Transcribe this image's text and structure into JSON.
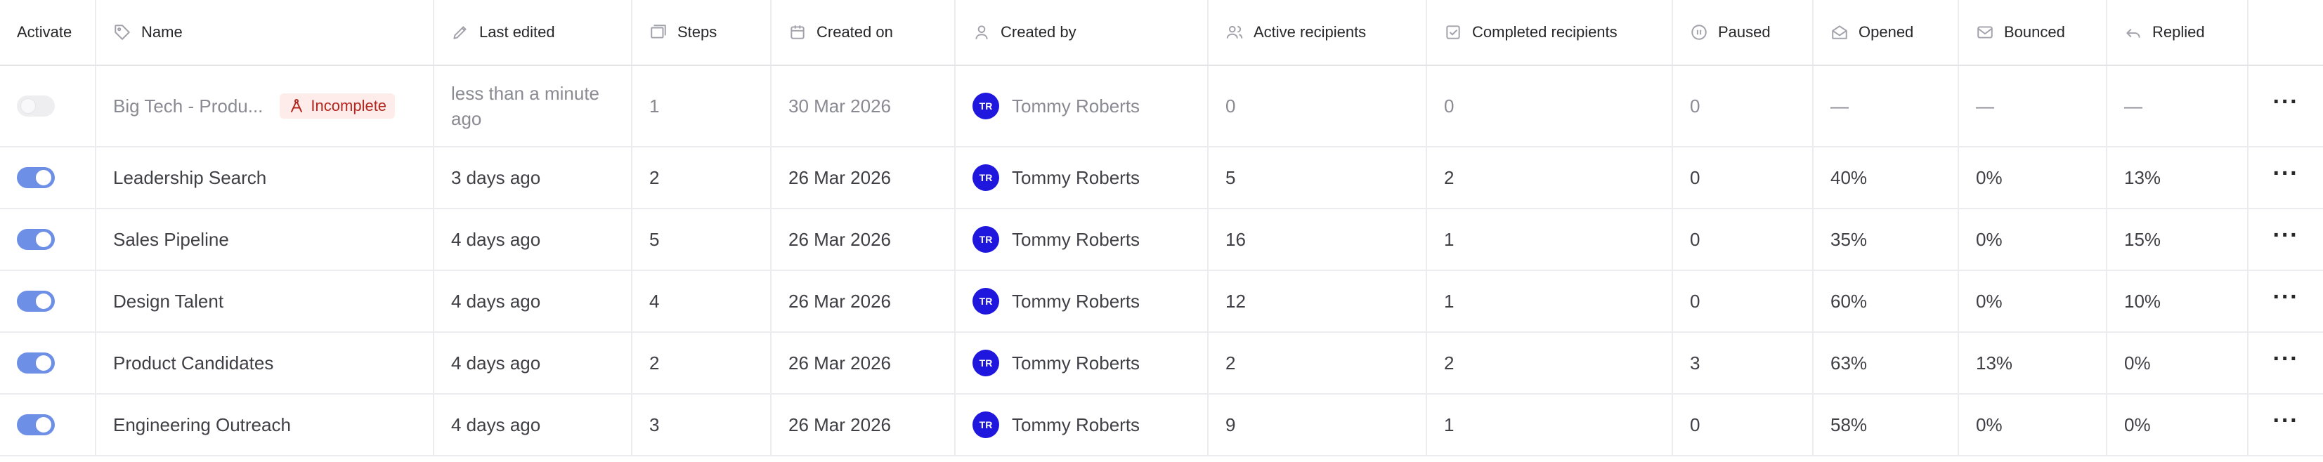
{
  "headers": {
    "activate": "Activate",
    "name": "Name",
    "last_edited": "Last edited",
    "steps": "Steps",
    "created_on": "Created on",
    "created_by": "Created by",
    "active_recipients": "Active recipients",
    "completed_recipients": "Completed recipients",
    "paused": "Paused",
    "opened": "Opened",
    "bounced": "Bounced",
    "replied": "Replied"
  },
  "header_icons": {
    "name": "tag-icon",
    "last_edited": "pencil-icon",
    "steps": "layers-icon",
    "created_on": "calendar-icon",
    "created_by": "user-icon",
    "active_recipients": "users-icon",
    "completed_recipients": "check-square-icon",
    "paused": "pause-circle-icon",
    "opened": "mail-open-icon",
    "bounced": "mail-icon",
    "replied": "reply-icon"
  },
  "colors": {
    "toggle_on": "#6d8fe6",
    "avatar_bg": "#1f17dd",
    "badge_bg": "#fdecea",
    "badge_text": "#b3261e"
  },
  "rows": [
    {
      "active": false,
      "name": "Big Tech - Produ...",
      "badge": "Incomplete",
      "last_edited": "less than a minute ago",
      "steps": "1",
      "created_on": "30 Mar 2026",
      "avatar": "TR",
      "created_by": "Tommy Roberts",
      "active_recipients": "0",
      "completed_recipients": "0",
      "paused": "0",
      "opened": "—",
      "bounced": "—",
      "replied": "—"
    },
    {
      "active": true,
      "name": "Leadership Search",
      "last_edited": "3 days ago",
      "steps": "2",
      "created_on": "26 Mar 2026",
      "avatar": "TR",
      "created_by": "Tommy Roberts",
      "active_recipients": "5",
      "completed_recipients": "2",
      "paused": "0",
      "opened": "40%",
      "bounced": "0%",
      "replied": "13%"
    },
    {
      "active": true,
      "name": "Sales Pipeline",
      "last_edited": "4 days ago",
      "steps": "5",
      "created_on": "26 Mar 2026",
      "avatar": "TR",
      "created_by": "Tommy Roberts",
      "active_recipients": "16",
      "completed_recipients": "1",
      "paused": "0",
      "opened": "35%",
      "bounced": "0%",
      "replied": "15%"
    },
    {
      "active": true,
      "name": "Design Talent",
      "last_edited": "4 days ago",
      "steps": "4",
      "created_on": "26 Mar 2026",
      "avatar": "TR",
      "created_by": "Tommy Roberts",
      "active_recipients": "12",
      "completed_recipients": "1",
      "paused": "0",
      "opened": "60%",
      "bounced": "0%",
      "replied": "10%"
    },
    {
      "active": true,
      "name": "Product Candidates",
      "last_edited": "4 days ago",
      "steps": "2",
      "created_on": "26 Mar 2026",
      "avatar": "TR",
      "created_by": "Tommy Roberts",
      "active_recipients": "2",
      "completed_recipients": "2",
      "paused": "3",
      "opened": "63%",
      "bounced": "13%",
      "replied": "0%"
    },
    {
      "active": true,
      "name": "Engineering Outreach",
      "last_edited": "4 days ago",
      "steps": "3",
      "created_on": "26 Mar 2026",
      "avatar": "TR",
      "created_by": "Tommy Roberts",
      "active_recipients": "9",
      "completed_recipients": "1",
      "paused": "0",
      "opened": "58%",
      "bounced": "0%",
      "replied": "0%"
    }
  ]
}
